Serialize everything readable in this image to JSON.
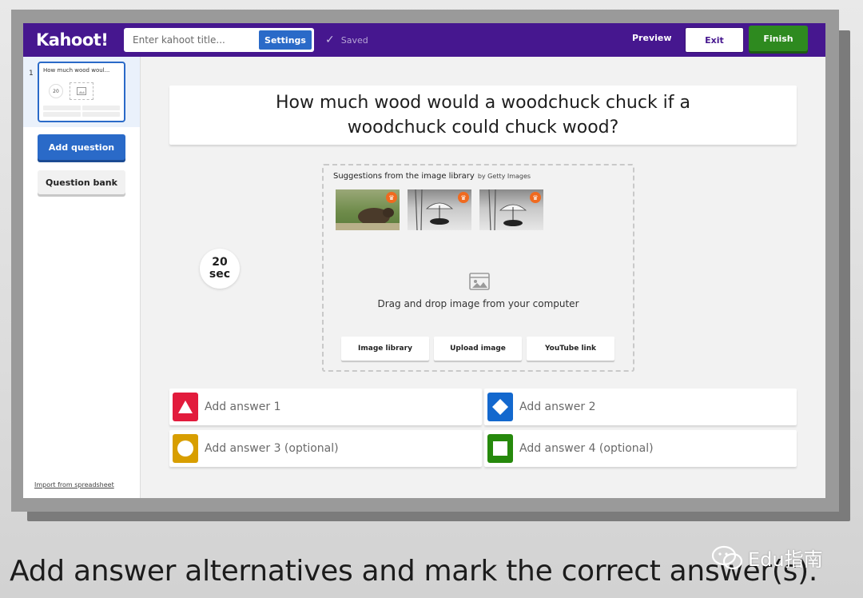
{
  "header": {
    "logo": "Kahoot!",
    "title_placeholder": "Enter kahoot title...",
    "settings_label": "Settings",
    "saved_label": "Saved",
    "preview_label": "Preview",
    "exit_label": "Exit",
    "finish_label": "Finish"
  },
  "sidebar": {
    "slide_number": "1",
    "slide_title": "How much wood woul...",
    "slide_timer": "20",
    "add_question_label": "Add question",
    "question_bank_label": "Question bank",
    "import_label": "Import from spreadsheet"
  },
  "question": {
    "text": "How much wood would a woodchuck chuck if a woodchuck could chuck wood?"
  },
  "timer": {
    "value": "20",
    "unit": "sec"
  },
  "media": {
    "suggestions_title": "Suggestions from the image library",
    "suggestions_by": "by Getty Images",
    "drag_text": "Drag and drop image from your computer",
    "buttons": [
      "Image library",
      "Upload image",
      "YouTube link"
    ]
  },
  "answers": [
    {
      "label": "Add answer 1",
      "color": "#e21b3c",
      "shape": "triangle"
    },
    {
      "label": "Add answer 2",
      "color": "#1368ce",
      "shape": "diamond"
    },
    {
      "label": "Add answer 3 (optional)",
      "color": "#d89e00",
      "shape": "circle"
    },
    {
      "label": "Add answer 4 (optional)",
      "color": "#26890c",
      "shape": "square"
    }
  ],
  "caption": "Add answer alternatives and mark the correct answer(s).",
  "watermark": "Edu指南",
  "colors": {
    "brand_purple": "#46178f",
    "blue_button": "#2a6ac8",
    "finish_green": "#2e8a1f"
  }
}
